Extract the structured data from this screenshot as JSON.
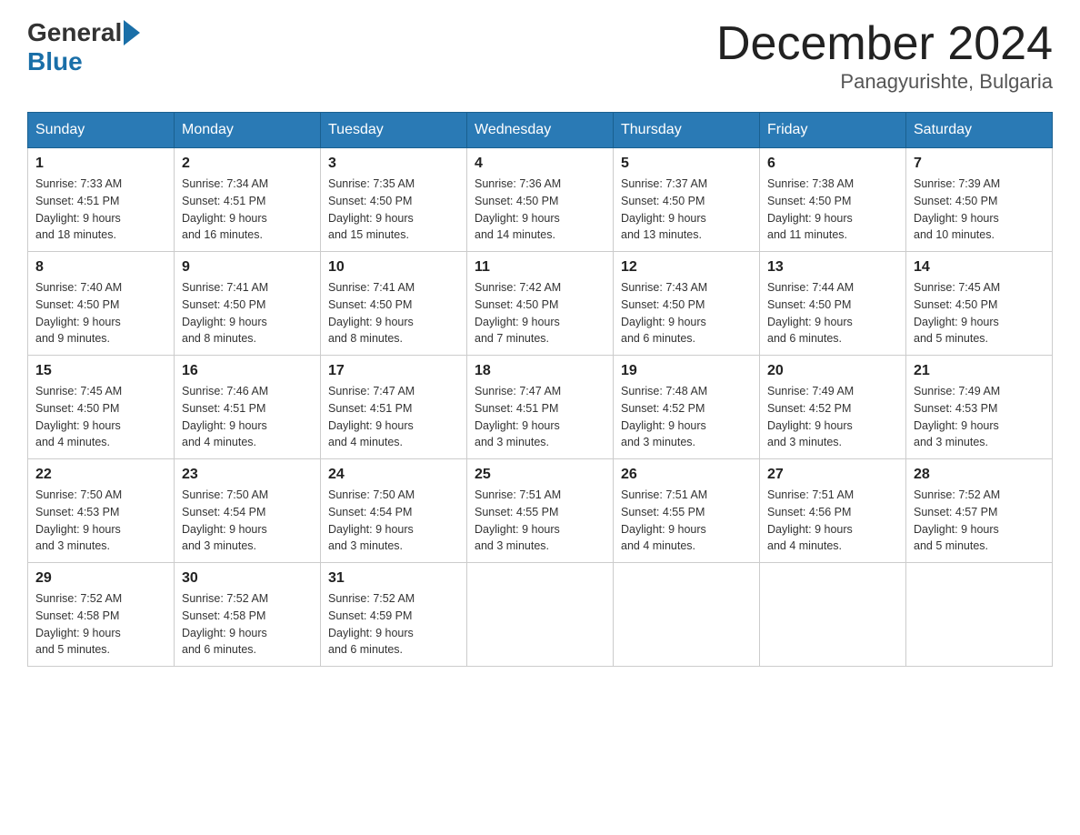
{
  "header": {
    "logo_general": "General",
    "logo_blue": "Blue",
    "month_title": "December 2024",
    "location": "Panagyurishte, Bulgaria"
  },
  "weekdays": [
    "Sunday",
    "Monday",
    "Tuesday",
    "Wednesday",
    "Thursday",
    "Friday",
    "Saturday"
  ],
  "weeks": [
    [
      {
        "day": "1",
        "sunrise": "7:33 AM",
        "sunset": "4:51 PM",
        "daylight": "9 hours and 18 minutes."
      },
      {
        "day": "2",
        "sunrise": "7:34 AM",
        "sunset": "4:51 PM",
        "daylight": "9 hours and 16 minutes."
      },
      {
        "day": "3",
        "sunrise": "7:35 AM",
        "sunset": "4:50 PM",
        "daylight": "9 hours and 15 minutes."
      },
      {
        "day": "4",
        "sunrise": "7:36 AM",
        "sunset": "4:50 PM",
        "daylight": "9 hours and 14 minutes."
      },
      {
        "day": "5",
        "sunrise": "7:37 AM",
        "sunset": "4:50 PM",
        "daylight": "9 hours and 13 minutes."
      },
      {
        "day": "6",
        "sunrise": "7:38 AM",
        "sunset": "4:50 PM",
        "daylight": "9 hours and 11 minutes."
      },
      {
        "day": "7",
        "sunrise": "7:39 AM",
        "sunset": "4:50 PM",
        "daylight": "9 hours and 10 minutes."
      }
    ],
    [
      {
        "day": "8",
        "sunrise": "7:40 AM",
        "sunset": "4:50 PM",
        "daylight": "9 hours and 9 minutes."
      },
      {
        "day": "9",
        "sunrise": "7:41 AM",
        "sunset": "4:50 PM",
        "daylight": "9 hours and 8 minutes."
      },
      {
        "day": "10",
        "sunrise": "7:41 AM",
        "sunset": "4:50 PM",
        "daylight": "9 hours and 8 minutes."
      },
      {
        "day": "11",
        "sunrise": "7:42 AM",
        "sunset": "4:50 PM",
        "daylight": "9 hours and 7 minutes."
      },
      {
        "day": "12",
        "sunrise": "7:43 AM",
        "sunset": "4:50 PM",
        "daylight": "9 hours and 6 minutes."
      },
      {
        "day": "13",
        "sunrise": "7:44 AM",
        "sunset": "4:50 PM",
        "daylight": "9 hours and 6 minutes."
      },
      {
        "day": "14",
        "sunrise": "7:45 AM",
        "sunset": "4:50 PM",
        "daylight": "9 hours and 5 minutes."
      }
    ],
    [
      {
        "day": "15",
        "sunrise": "7:45 AM",
        "sunset": "4:50 PM",
        "daylight": "9 hours and 4 minutes."
      },
      {
        "day": "16",
        "sunrise": "7:46 AM",
        "sunset": "4:51 PM",
        "daylight": "9 hours and 4 minutes."
      },
      {
        "day": "17",
        "sunrise": "7:47 AM",
        "sunset": "4:51 PM",
        "daylight": "9 hours and 4 minutes."
      },
      {
        "day": "18",
        "sunrise": "7:47 AM",
        "sunset": "4:51 PM",
        "daylight": "9 hours and 3 minutes."
      },
      {
        "day": "19",
        "sunrise": "7:48 AM",
        "sunset": "4:52 PM",
        "daylight": "9 hours and 3 minutes."
      },
      {
        "day": "20",
        "sunrise": "7:49 AM",
        "sunset": "4:52 PM",
        "daylight": "9 hours and 3 minutes."
      },
      {
        "day": "21",
        "sunrise": "7:49 AM",
        "sunset": "4:53 PM",
        "daylight": "9 hours and 3 minutes."
      }
    ],
    [
      {
        "day": "22",
        "sunrise": "7:50 AM",
        "sunset": "4:53 PM",
        "daylight": "9 hours and 3 minutes."
      },
      {
        "day": "23",
        "sunrise": "7:50 AM",
        "sunset": "4:54 PM",
        "daylight": "9 hours and 3 minutes."
      },
      {
        "day": "24",
        "sunrise": "7:50 AM",
        "sunset": "4:54 PM",
        "daylight": "9 hours and 3 minutes."
      },
      {
        "day": "25",
        "sunrise": "7:51 AM",
        "sunset": "4:55 PM",
        "daylight": "9 hours and 3 minutes."
      },
      {
        "day": "26",
        "sunrise": "7:51 AM",
        "sunset": "4:55 PM",
        "daylight": "9 hours and 4 minutes."
      },
      {
        "day": "27",
        "sunrise": "7:51 AM",
        "sunset": "4:56 PM",
        "daylight": "9 hours and 4 minutes."
      },
      {
        "day": "28",
        "sunrise": "7:52 AM",
        "sunset": "4:57 PM",
        "daylight": "9 hours and 5 minutes."
      }
    ],
    [
      {
        "day": "29",
        "sunrise": "7:52 AM",
        "sunset": "4:58 PM",
        "daylight": "9 hours and 5 minutes."
      },
      {
        "day": "30",
        "sunrise": "7:52 AM",
        "sunset": "4:58 PM",
        "daylight": "9 hours and 6 minutes."
      },
      {
        "day": "31",
        "sunrise": "7:52 AM",
        "sunset": "4:59 PM",
        "daylight": "9 hours and 6 minutes."
      },
      null,
      null,
      null,
      null
    ]
  ],
  "labels": {
    "sunrise": "Sunrise:",
    "sunset": "Sunset:",
    "daylight": "Daylight:"
  }
}
